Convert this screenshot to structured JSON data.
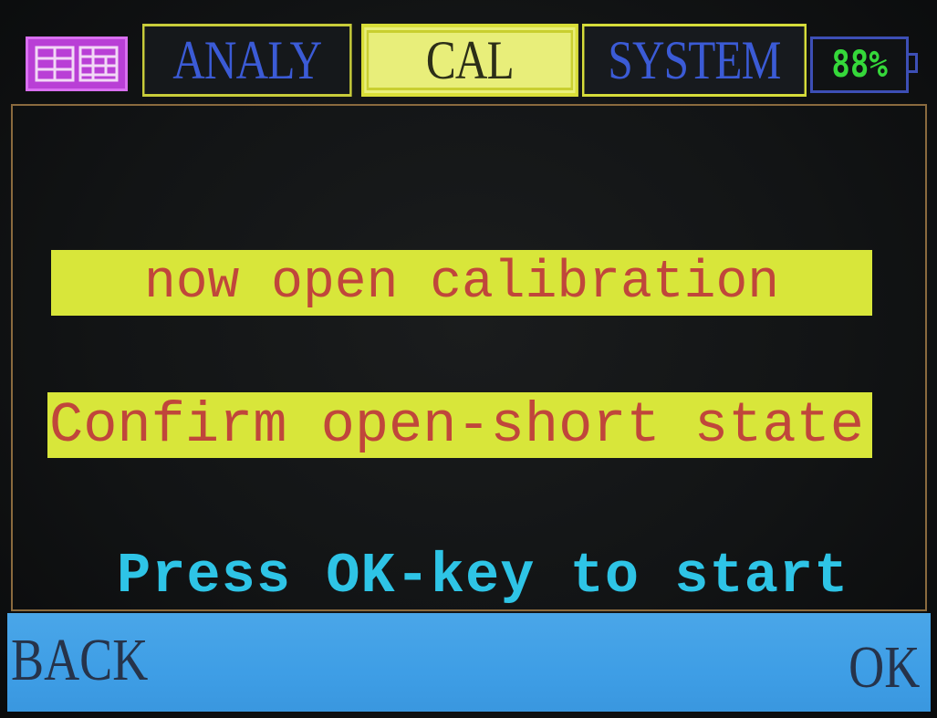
{
  "header": {
    "logo_icon": "chinese-characters-logo-icon",
    "tabs": [
      {
        "label": "ANALY"
      },
      {
        "label": "CAL"
      },
      {
        "label": "SYSTEM"
      }
    ],
    "battery_percent": "88%",
    "battery_icon": "battery-icon"
  },
  "main": {
    "banner_1": "now open calibration",
    "banner_2": "Confirm open-short state",
    "prompt": "Press OK-key to start"
  },
  "softkeys": {
    "back": "BACK",
    "ok": "OK"
  },
  "colors": {
    "tab_text": "#3b5bd6",
    "active_tab_bg": "#e8ee7a",
    "banner_bg": "#d8e63a",
    "banner_text": "#c0463b",
    "prompt_text": "#2ec4e6",
    "softkey_bar": "#4aa6e8",
    "battery_text": "#35d83a",
    "logo_bg": "#b93fd6"
  }
}
